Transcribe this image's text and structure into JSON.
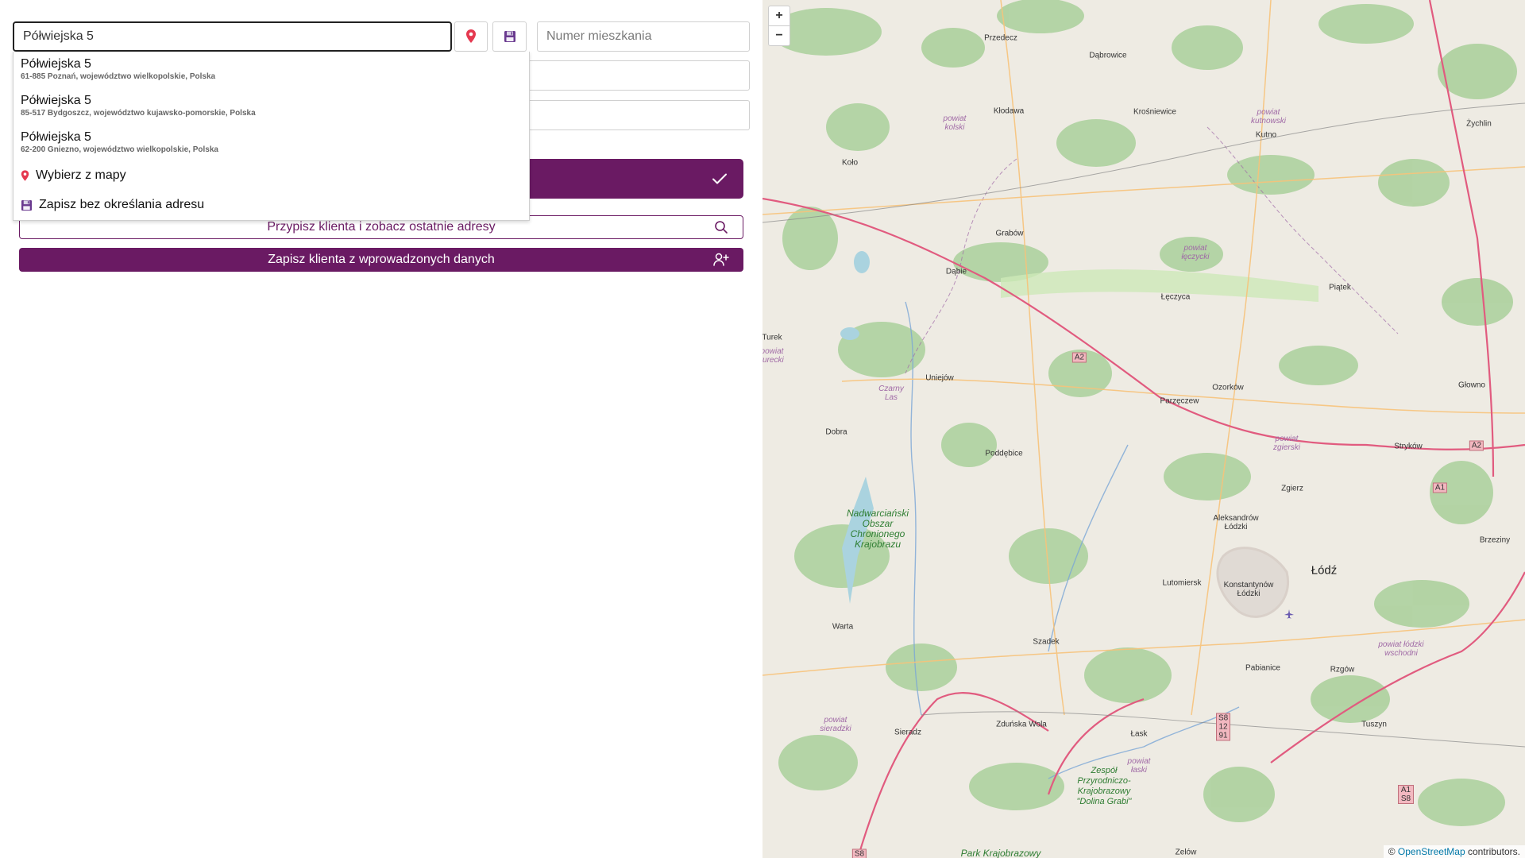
{
  "form": {
    "address_value": "Półwiejska 5",
    "apartment_placeholder": "Numer mieszkania"
  },
  "suggestions": [
    {
      "main": "Półwiejska 5",
      "sub": "61-885 Poznań, województwo wielkopolskie, Polska"
    },
    {
      "main": "Półwiejska 5",
      "sub": "85-517 Bydgoszcz, województwo kujawsko-pomorskie, Polska"
    },
    {
      "main": "Półwiejska 5",
      "sub": "62-200 Gniezno, województwo wielkopolskie, Polska"
    }
  ],
  "dropdown_options": {
    "pick_from_map": "Wybierz z mapy",
    "save_without_address": "Zapisz bez określania adresu"
  },
  "buttons": {
    "assign_client": "Przypisz klienta i zobacz ostatnie adresy",
    "save_client": "Zapisz klienta z wprowadzonych danych"
  },
  "map": {
    "zoom_in": "+",
    "zoom_out": "−",
    "attribution_prefix": "© ",
    "attribution_link": "OpenStreetMap",
    "attribution_suffix": " contributors.",
    "labels": {
      "przedecz": "Przedecz",
      "dabrowice": "Dąbrowice",
      "klodawa": "Kłodawa",
      "krosniewice": "Krośniewice",
      "kutno": "Kutno",
      "zychlin": "Żychlin",
      "kolo": "Koło",
      "grabow": "Grabów",
      "dabie": "Dąbie",
      "leczyca": "Łęczyca",
      "piatek": "Piątek",
      "turek": "Turek",
      "uniejow": "Uniejów",
      "ozorkow": "Ozorków",
      "parzeczew": "Parzęczew",
      "glowno": "Głowno",
      "dobra": "Dobra",
      "poddebice": "Poddębice",
      "strykow": "Stryków",
      "zgierz": "Zgierz",
      "aleksandrow": "Aleksandrów Łódzki",
      "brzeziny": "Brzeziny",
      "lodz": "Łódź",
      "lutomiersk": "Lutomiersk",
      "konstantynow": "Konstantynów Łódzki",
      "warta": "Warta",
      "szadek": "Szadek",
      "pabianice": "Pabianice",
      "rzgow": "Rzgów",
      "sieradz": "Sieradz",
      "zdunska": "Zduńska Wola",
      "lask": "Łask",
      "tuszyn": "Tuszyn",
      "zelow": "Zelów"
    },
    "counties": {
      "kolski": "powiat kolski",
      "kutnowski": "powiat kutnowski",
      "leczycki": "powiat łęczycki",
      "turecki": "powiat turecki",
      "czarny_las": "Czarny Las",
      "zgierski": "powiat zgierski",
      "lodzki_wsch": "powiat łódzki wschodni",
      "sieradzki": "powiat sieradzki",
      "laski": "powiat łaski"
    },
    "parks": {
      "nadwarcianski": "Nadwarciański Obszar Chronionego Krajobrazu",
      "dolina_grabi": "Zespół Przyrodniczo-Krajobrazowy \"Dolina Grabi\"",
      "park_krajobrazowy": "Park Krajobrazowy"
    },
    "shields": {
      "a2_west": "A2",
      "a2_east": "A2",
      "a1_north": "A1",
      "s8_12_91": "S8 12 91",
      "a1_s8": "A1 S8",
      "s8_south": "S8"
    }
  },
  "colors": {
    "accent": "#6a1a63",
    "pin": "#e53950"
  }
}
